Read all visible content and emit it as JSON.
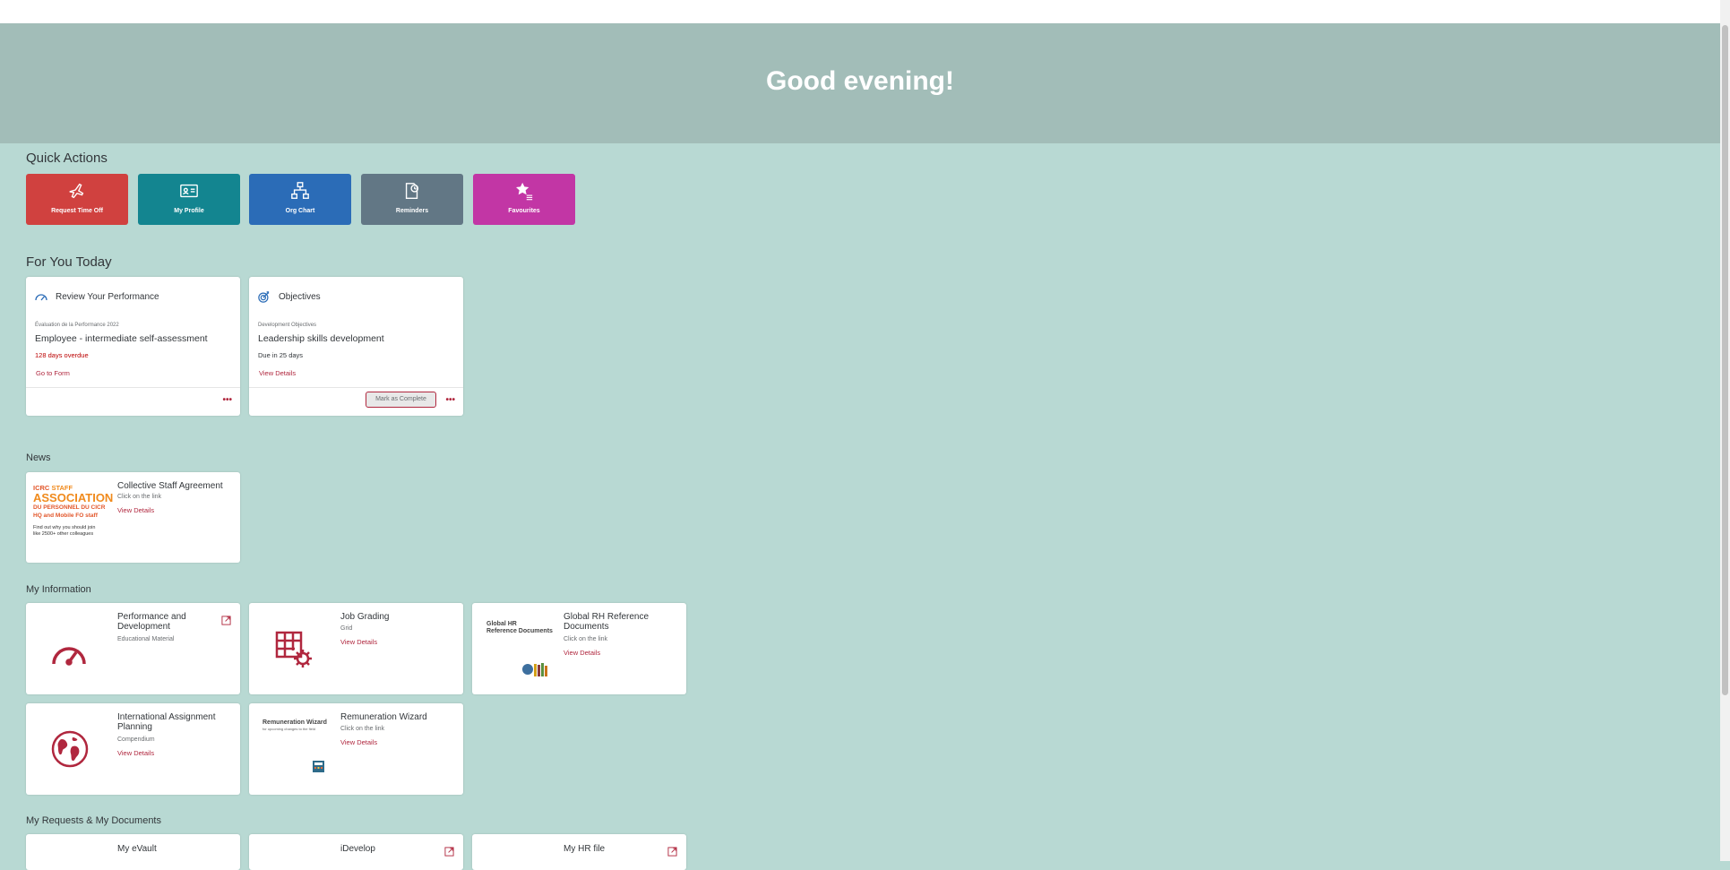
{
  "greeting": "Good evening!",
  "quick_actions": {
    "title": "Quick Actions",
    "items": [
      {
        "label": "Request Time Off",
        "icon": "airplane-icon",
        "color": "#d0413f"
      },
      {
        "label": "My Profile",
        "icon": "id-card-icon",
        "color": "#138590"
      },
      {
        "label": "Org Chart",
        "icon": "org-chart-icon",
        "color": "#2b6cb7"
      },
      {
        "label": "Reminders",
        "icon": "reminder-icon",
        "color": "#627785"
      },
      {
        "label": "Favourites",
        "icon": "star-list-icon",
        "color": "#c236a5"
      }
    ]
  },
  "for_you_today": {
    "title": "For You Today",
    "cards": [
      {
        "header": "Review Your Performance",
        "icon": "gauge-icon",
        "subtitle": "Évaluation de la Performance 2022",
        "main": "Employee - intermediate self-assessment",
        "status": "128 days overdue",
        "status_color": "#bb0000",
        "link": "Go to Form"
      },
      {
        "header": "Objectives",
        "icon": "target-icon",
        "subtitle": "Development Objectives",
        "main": "Leadership skills development",
        "status": "Due in 25 days",
        "status_color": "#32363a",
        "link": "View Details",
        "button": "Mark as Complete"
      }
    ],
    "more_label": "•••"
  },
  "news": {
    "title": "News",
    "items": [
      {
        "title": "Collective Staff Agreement",
        "subtitle": "Click on the link",
        "link": "View Details",
        "thumb": {
          "line1a": "ICRC",
          "line1b": "STAFF",
          "line2": "ASSOCIATION",
          "line3": "DU PERSONNEL DU CICR",
          "line4": "HQ and Mobile FO staff",
          "line5": "Find out why you should join",
          "line6": "like 2500+ other colleagues"
        }
      }
    ]
  },
  "my_information": {
    "title": "My Information",
    "items": [
      {
        "title": "Performance and Development",
        "subtitle": "Educational Material",
        "icon": "gauge-icon"
      },
      {
        "title": "Job Grading",
        "subtitle": "Grid",
        "link": "View Details",
        "icon": "grid-gear-icon"
      },
      {
        "title": "Global RH Reference Documents",
        "subtitle": "Click on the link",
        "link": "View Details",
        "thumb_l1": "Global HR",
        "thumb_l2": "Reference Documents"
      },
      {
        "title": "International Assignment Planning",
        "subtitle": "Compendium",
        "link": "View Details",
        "icon": "globe-icon"
      },
      {
        "title": "Remuneration Wizard",
        "subtitle": "Click on the link",
        "link": "View Details",
        "thumb_l1": "Remuneration Wizard",
        "thumb_l2": "for upcoming changes to the field"
      }
    ]
  },
  "my_requests": {
    "title": "My Requests & My Documents",
    "items": [
      {
        "title": "My eVault"
      },
      {
        "title": "iDevelop"
      },
      {
        "title": "My HR file"
      }
    ]
  }
}
